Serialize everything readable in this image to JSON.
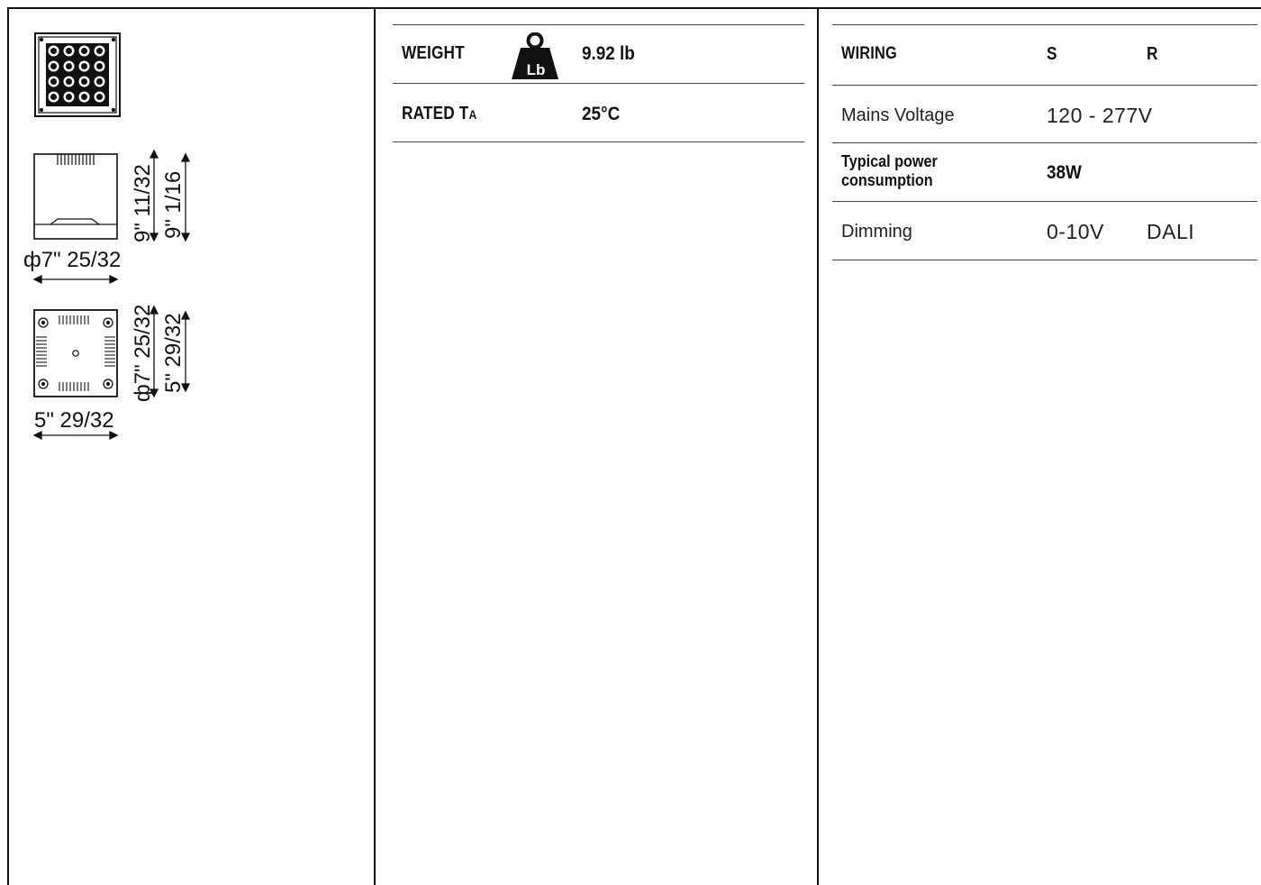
{
  "drawings": {
    "side_view": {
      "height_outer": "9\" 11/32",
      "height_inner": "9\" 1/16",
      "diameter": "ф7\" 25/32"
    },
    "bottom_view": {
      "diameter": "ф7\" 25/32",
      "depth": "5\" 29/32",
      "width": "5\" 29/32"
    }
  },
  "properties": {
    "weight_label": "WEIGHT",
    "weight_icon_text": "Lb",
    "weight_icon": "weight-icon",
    "weight_value": "9.92 lb",
    "rated_label_main": "RATED T",
    "rated_label_sub": "A",
    "rated_value": "25°C"
  },
  "wiring": {
    "header": "WIRING",
    "col_s": "S",
    "col_r": "R",
    "rows": [
      {
        "label": "Mains Voltage",
        "value_s": "120 - 277V",
        "value_r": ""
      },
      {
        "label": "Typical power consumption",
        "value_s": "38W",
        "value_r": ""
      },
      {
        "label": "Dimming",
        "value_s": "0-10V",
        "value_r": "DALI"
      }
    ]
  }
}
